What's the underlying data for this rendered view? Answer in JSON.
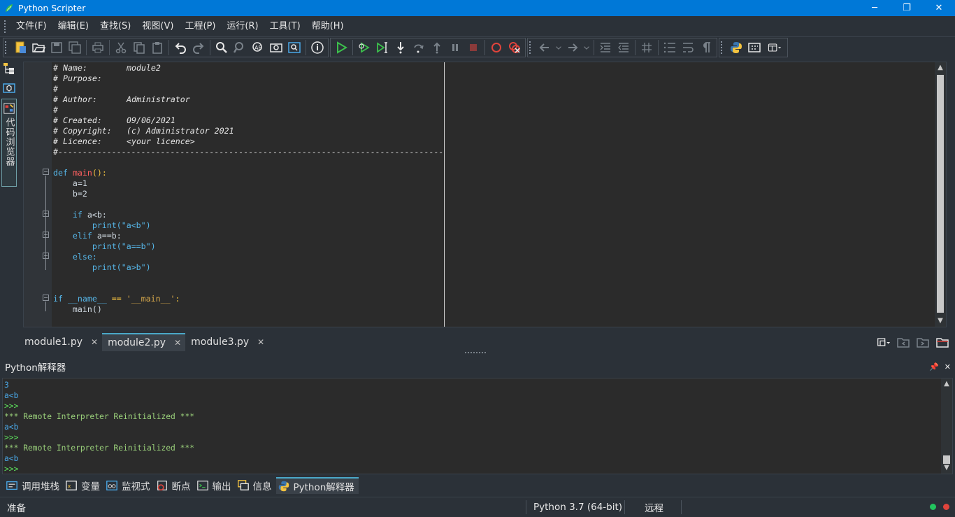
{
  "window": {
    "title": "Python Scripter",
    "controls": [
      "─",
      "❐",
      "✕"
    ]
  },
  "menu": [
    "文件(F)",
    "编辑(E)",
    "查找(S)",
    "视图(V)",
    "工程(P)",
    "运行(R)",
    "工具(T)",
    "帮助(H)"
  ],
  "side": {
    "code_browser_label": "代码浏览器"
  },
  "editor": {
    "header": [
      {
        "k": "# Name:",
        "v": "module2"
      },
      {
        "k": "# Purpose:",
        "v": ""
      },
      {
        "k": "#",
        "v": ""
      },
      {
        "k": "# Author:",
        "v": "Administrator"
      },
      {
        "k": "#",
        "v": ""
      },
      {
        "k": "# Created:",
        "v": "09/06/2021"
      },
      {
        "k": "# Copyright:",
        "v": "(c) Administrator 2021"
      },
      {
        "k": "# Licence:",
        "v": "<your licence>"
      }
    ],
    "rule": "#-------------------------------------------------------------------------------",
    "code": {
      "def_kw": "def",
      "func": "main",
      "func_sig": "():",
      "a_assign": "a=1",
      "b_assign": "b=2",
      "if_kw": "if",
      "if_cond": "a<b:",
      "print1": "print(",
      "str1": "\"a<b\"",
      "close1": ")",
      "elif_kw": "elif",
      "elif_cond": "a==b:",
      "print2": "print(",
      "str2": "\"a==b\"",
      "close2": ")",
      "else_kw": "else:",
      "print3": "print(",
      "str3": "\"a>b\"",
      "close3": ")",
      "if2_kw": "if",
      "name_var": "__name__",
      "eq": "==",
      "main_str": "'__main__'",
      "colon": ":",
      "main_call": "main()"
    }
  },
  "tabs": [
    {
      "label": "module1.py",
      "active": false
    },
    {
      "label": "module2.py",
      "active": true
    },
    {
      "label": "module3.py",
      "active": false
    }
  ],
  "interpreter": {
    "title": "Python解释器",
    "pin": "📌",
    "close": "✕",
    "lines": [
      {
        "cls": "c-num",
        "text": "3"
      },
      {
        "cls": "c-num",
        "text": "a<b"
      },
      {
        "cls": "c-prompt",
        "text": ">>>"
      },
      {
        "cls": "c-msg",
        "text": "*** Remote Interpreter Reinitialized ***"
      },
      {
        "cls": "c-num",
        "text": "a<b"
      },
      {
        "cls": "c-prompt",
        "text": ">>>"
      },
      {
        "cls": "c-msg",
        "text": "*** Remote Interpreter Reinitialized ***"
      },
      {
        "cls": "c-num",
        "text": "a<b"
      },
      {
        "cls": "c-prompt",
        "text": ">>>"
      }
    ]
  },
  "bottom_tabs": [
    "调用堆栈",
    "变量",
    "监视式",
    "断点",
    "输出",
    "信息",
    "Python解释器"
  ],
  "status": {
    "left": "准备",
    "python": "Python 3.7 (64-bit)",
    "mode": "远程",
    "led_green": "#22c55e",
    "led_red": "#e0443c"
  },
  "colors": {
    "titlebar": "#0078d7",
    "accent": "#4aa8c8"
  }
}
